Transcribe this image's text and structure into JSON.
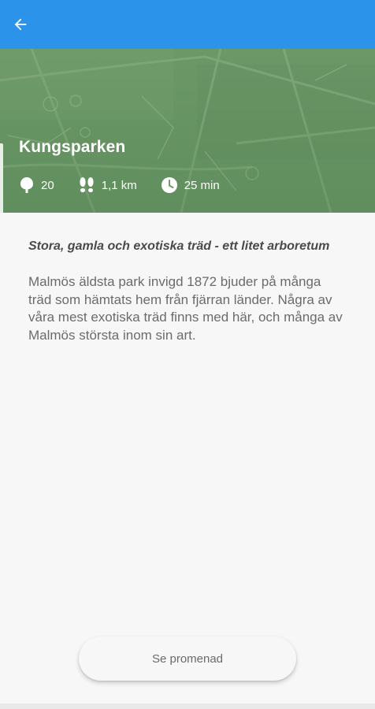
{
  "colors": {
    "app_bar": "#2b93ea",
    "hero_green": "#6f9a6a",
    "background": "#f7f7f7"
  },
  "app_bar": {
    "back_icon": "arrow-left-icon"
  },
  "hero": {
    "title": "Kungsparken",
    "stats": {
      "trees": "20",
      "trees_icon": "tree-icon",
      "distance": "1,1 km",
      "distance_icon": "footsteps-icon",
      "duration": "25 min",
      "duration_icon": "clock-icon"
    }
  },
  "content": {
    "subtitle": "Stora, gamla och exotiska träd - ett litet arboretum",
    "description": "Malmös äldsta park invigd 1872 bjuder på många träd som hämtats hem från fjärran länder. Några av våra mest exotiska träd finns med här, och många av Malmös största inom sin art."
  },
  "cta": {
    "label": "Se promenad"
  }
}
